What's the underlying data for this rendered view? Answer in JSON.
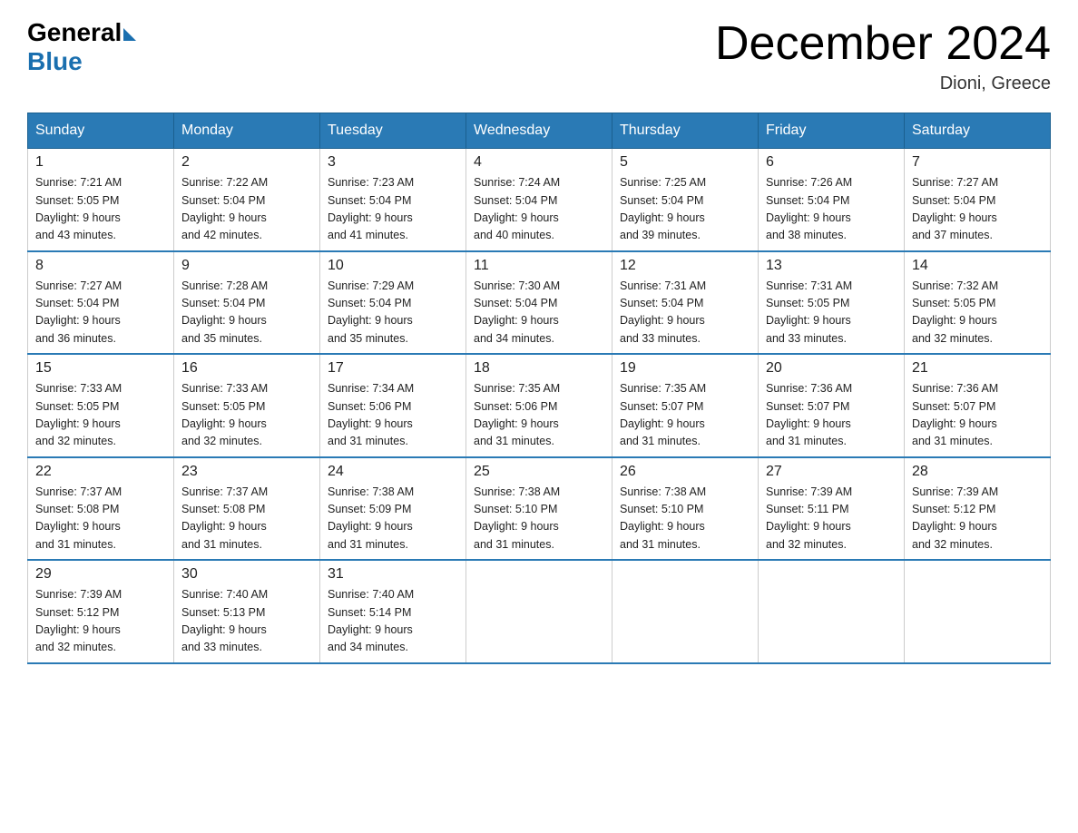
{
  "logo": {
    "text_general": "General",
    "text_blue": "Blue"
  },
  "header": {
    "title": "December 2024",
    "location": "Dioni, Greece"
  },
  "days_of_week": [
    "Sunday",
    "Monday",
    "Tuesday",
    "Wednesday",
    "Thursday",
    "Friday",
    "Saturday"
  ],
  "weeks": [
    [
      {
        "day": "1",
        "sunrise": "7:21 AM",
        "sunset": "5:05 PM",
        "daylight": "9 hours and 43 minutes."
      },
      {
        "day": "2",
        "sunrise": "7:22 AM",
        "sunset": "5:04 PM",
        "daylight": "9 hours and 42 minutes."
      },
      {
        "day": "3",
        "sunrise": "7:23 AM",
        "sunset": "5:04 PM",
        "daylight": "9 hours and 41 minutes."
      },
      {
        "day": "4",
        "sunrise": "7:24 AM",
        "sunset": "5:04 PM",
        "daylight": "9 hours and 40 minutes."
      },
      {
        "day": "5",
        "sunrise": "7:25 AM",
        "sunset": "5:04 PM",
        "daylight": "9 hours and 39 minutes."
      },
      {
        "day": "6",
        "sunrise": "7:26 AM",
        "sunset": "5:04 PM",
        "daylight": "9 hours and 38 minutes."
      },
      {
        "day": "7",
        "sunrise": "7:27 AM",
        "sunset": "5:04 PM",
        "daylight": "9 hours and 37 minutes."
      }
    ],
    [
      {
        "day": "8",
        "sunrise": "7:27 AM",
        "sunset": "5:04 PM",
        "daylight": "9 hours and 36 minutes."
      },
      {
        "day": "9",
        "sunrise": "7:28 AM",
        "sunset": "5:04 PM",
        "daylight": "9 hours and 35 minutes."
      },
      {
        "day": "10",
        "sunrise": "7:29 AM",
        "sunset": "5:04 PM",
        "daylight": "9 hours and 35 minutes."
      },
      {
        "day": "11",
        "sunrise": "7:30 AM",
        "sunset": "5:04 PM",
        "daylight": "9 hours and 34 minutes."
      },
      {
        "day": "12",
        "sunrise": "7:31 AM",
        "sunset": "5:04 PM",
        "daylight": "9 hours and 33 minutes."
      },
      {
        "day": "13",
        "sunrise": "7:31 AM",
        "sunset": "5:05 PM",
        "daylight": "9 hours and 33 minutes."
      },
      {
        "day": "14",
        "sunrise": "7:32 AM",
        "sunset": "5:05 PM",
        "daylight": "9 hours and 32 minutes."
      }
    ],
    [
      {
        "day": "15",
        "sunrise": "7:33 AM",
        "sunset": "5:05 PM",
        "daylight": "9 hours and 32 minutes."
      },
      {
        "day": "16",
        "sunrise": "7:33 AM",
        "sunset": "5:05 PM",
        "daylight": "9 hours and 32 minutes."
      },
      {
        "day": "17",
        "sunrise": "7:34 AM",
        "sunset": "5:06 PM",
        "daylight": "9 hours and 31 minutes."
      },
      {
        "day": "18",
        "sunrise": "7:35 AM",
        "sunset": "5:06 PM",
        "daylight": "9 hours and 31 minutes."
      },
      {
        "day": "19",
        "sunrise": "7:35 AM",
        "sunset": "5:07 PM",
        "daylight": "9 hours and 31 minutes."
      },
      {
        "day": "20",
        "sunrise": "7:36 AM",
        "sunset": "5:07 PM",
        "daylight": "9 hours and 31 minutes."
      },
      {
        "day": "21",
        "sunrise": "7:36 AM",
        "sunset": "5:07 PM",
        "daylight": "9 hours and 31 minutes."
      }
    ],
    [
      {
        "day": "22",
        "sunrise": "7:37 AM",
        "sunset": "5:08 PM",
        "daylight": "9 hours and 31 minutes."
      },
      {
        "day": "23",
        "sunrise": "7:37 AM",
        "sunset": "5:08 PM",
        "daylight": "9 hours and 31 minutes."
      },
      {
        "day": "24",
        "sunrise": "7:38 AM",
        "sunset": "5:09 PM",
        "daylight": "9 hours and 31 minutes."
      },
      {
        "day": "25",
        "sunrise": "7:38 AM",
        "sunset": "5:10 PM",
        "daylight": "9 hours and 31 minutes."
      },
      {
        "day": "26",
        "sunrise": "7:38 AM",
        "sunset": "5:10 PM",
        "daylight": "9 hours and 31 minutes."
      },
      {
        "day": "27",
        "sunrise": "7:39 AM",
        "sunset": "5:11 PM",
        "daylight": "9 hours and 32 minutes."
      },
      {
        "day": "28",
        "sunrise": "7:39 AM",
        "sunset": "5:12 PM",
        "daylight": "9 hours and 32 minutes."
      }
    ],
    [
      {
        "day": "29",
        "sunrise": "7:39 AM",
        "sunset": "5:12 PM",
        "daylight": "9 hours and 32 minutes."
      },
      {
        "day": "30",
        "sunrise": "7:40 AM",
        "sunset": "5:13 PM",
        "daylight": "9 hours and 33 minutes."
      },
      {
        "day": "31",
        "sunrise": "7:40 AM",
        "sunset": "5:14 PM",
        "daylight": "9 hours and 34 minutes."
      },
      null,
      null,
      null,
      null
    ]
  ],
  "labels": {
    "sunrise": "Sunrise:",
    "sunset": "Sunset:",
    "daylight": "Daylight:"
  }
}
